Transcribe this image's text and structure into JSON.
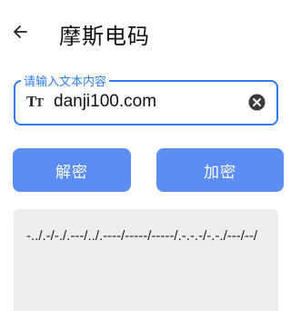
{
  "header": {
    "title": "摩斯电码",
    "back_icon": "arrow-left-icon"
  },
  "input": {
    "label": "请输入文本内容",
    "value": "danji100.com",
    "leading_icon": "text-format-icon",
    "trailing_icon": "clear-circle-icon"
  },
  "buttons": {
    "decrypt_label": "解密",
    "encrypt_label": "加密"
  },
  "output": {
    "text": "-../.-/-./.---/../.----/-----/-----/.-.-.-/-.-./---/--/"
  },
  "colors": {
    "accent": "#2f7bf5",
    "button": "#5b8df5",
    "output_bg": "#ededed"
  }
}
